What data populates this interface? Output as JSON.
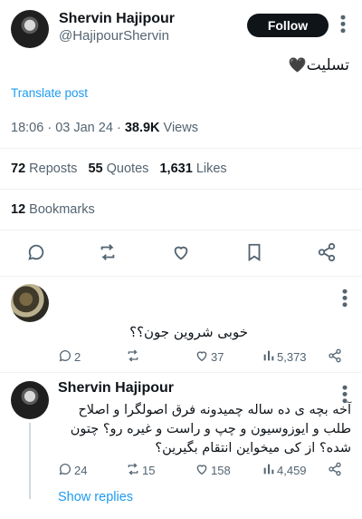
{
  "tweet": {
    "author_name": "Shervin Hajipour",
    "author_handle": "@HajipourShervin",
    "follow_label": "Follow",
    "text": "تسلیت",
    "emoji": "🖤",
    "translate_label": "Translate post",
    "time": "18:06",
    "date": "03 Jan 24",
    "views_count": "38.9K",
    "views_label": "Views",
    "reposts_count": "72",
    "reposts_label": "Reposts",
    "quotes_count": "55",
    "quotes_label": "Quotes",
    "likes_count": "1,631",
    "likes_label": "Likes",
    "bookmarks_count": "12",
    "bookmarks_label": "Bookmarks"
  },
  "reply1": {
    "text": "خوبی شروین جون؟؟",
    "replies": "2",
    "reposts": "",
    "likes": "37",
    "views": "5,373"
  },
  "reply2": {
    "author_name": "Shervin Hajipour",
    "text": "آخه بچه ی ده ساله چمیدونه فرق اصولگرا و اصلاح طلب و ایوزوسیون و چپ و راست و غیره رو؟ چتون شده؟ از کی میخواین انتقام بگیرین؟",
    "replies": "24",
    "reposts": "15",
    "likes": "158",
    "views": "4,459"
  },
  "show_replies_label": "Show replies",
  "colors": {
    "accent": "#1d9bf0",
    "text_primary": "#0f1419",
    "text_secondary": "#536471",
    "divider": "#eff3f4"
  },
  "icons": [
    "more-icon",
    "reply-icon",
    "repost-icon",
    "like-icon",
    "share-icon",
    "views-icon",
    "black-heart-emoji"
  ]
}
